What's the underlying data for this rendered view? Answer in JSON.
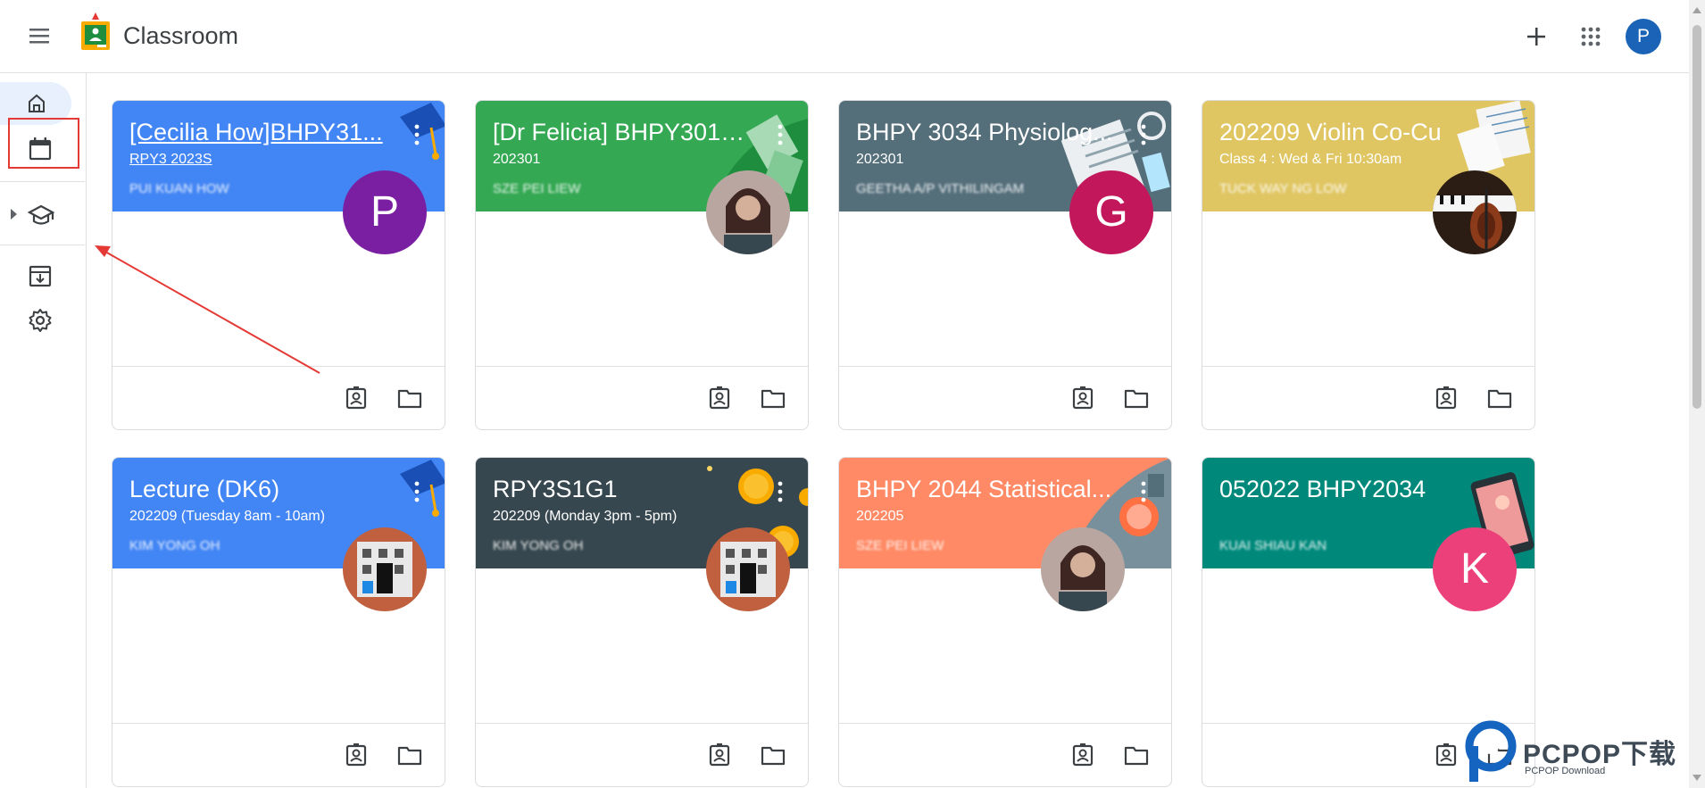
{
  "app": {
    "title": "Classroom",
    "user_initial": "P"
  },
  "colors": {
    "accent": "#1a73e8",
    "avatar_top": "#1a63b6",
    "annotation": "#e53935"
  },
  "sidebar": {
    "items": [
      {
        "name": "home",
        "icon": "home-icon"
      },
      {
        "name": "calendar",
        "icon": "calendar-icon"
      },
      {
        "name": "enrolled",
        "icon": "school-icon"
      },
      {
        "name": "archived",
        "icon": "archive-icon"
      },
      {
        "name": "settings",
        "icon": "gear-icon"
      }
    ]
  },
  "cards": [
    {
      "title": "[Cecilia How]BHPY31...",
      "subtitle": "RPY3 2023S",
      "teacher": "PUI KUAN HOW",
      "header_color": "#4285f4",
      "avatar_initial": "P",
      "avatar_color": "#7b1fa2"
    },
    {
      "title": "[Dr Felicia] BHPY3014...",
      "subtitle": "202301",
      "teacher": "SZE PEI LIEW",
      "header_color": "#34a853",
      "avatar_initial": "",
      "avatar_color": "#6d4c41"
    },
    {
      "title": "BHPY 3034 Physiolog...",
      "subtitle": "202301",
      "teacher": "GEETHA A/P VITHILINGAM",
      "header_color": "#546e7a",
      "avatar_initial": "G",
      "avatar_color": "#c2185b"
    },
    {
      "title": "202209 Violin Co-Cu",
      "subtitle": "Class 4 : Wed & Fri 10:30am",
      "teacher": "TUCK WAY NG LOW",
      "header_color": "#e0c663",
      "avatar_initial": "",
      "avatar_color": "#3e2723"
    },
    {
      "title": "Lecture (DK6)",
      "subtitle": "202209 (Tuesday 8am - 10am)",
      "teacher": "KIM YONG OH",
      "header_color": "#4285f4",
      "avatar_initial": "",
      "avatar_color": "#bf5b3c"
    },
    {
      "title": "RPY3S1G1",
      "subtitle": "202209 (Monday 3pm - 5pm)",
      "teacher": "KIM YONG OH",
      "header_color": "#37474f",
      "avatar_initial": "",
      "avatar_color": "#bf5b3c"
    },
    {
      "title": "BHPY 2044 Statistical...",
      "subtitle": "202205",
      "teacher": "SZE PEI LIEW",
      "header_color": "#ff8a65",
      "avatar_initial": "",
      "avatar_color": "#6d4c41"
    },
    {
      "title": "052022 BHPY2034",
      "subtitle": "",
      "teacher": "KUAI SHIAU KAN",
      "header_color": "#00897b",
      "avatar_initial": "K",
      "avatar_color": "#ec407a"
    }
  ],
  "watermark": {
    "brand": "PCPOP下载",
    "sub": "PCPOP Download"
  }
}
